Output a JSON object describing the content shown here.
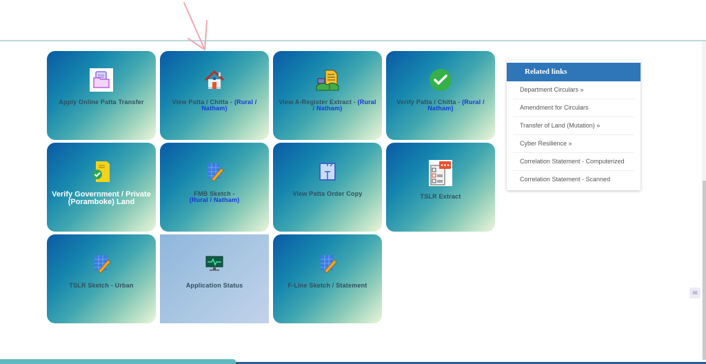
{
  "tiles": [
    {
      "label": "Apply Online Patta Transfer",
      "highlight": "",
      "icon": "folder-document-icon"
    },
    {
      "label": "View Patta / Chitta - ",
      "highlight": "(Rural / Natham)",
      "icon": "house-icon"
    },
    {
      "label": "View A-Register Extract - ",
      "highlight": "(Rural / Natham)",
      "icon": "land-register-icon"
    },
    {
      "label": "Verify Patta / Chitta - ",
      "highlight": "(Rural / Natham)",
      "icon": "check-circle-icon"
    },
    {
      "label": "Verify Government / Private (Poramboke) Land",
      "highlight": "",
      "icon": "verified-document-icon"
    },
    {
      "label": "FMB Sketch - ",
      "highlight": "(Rural / Natham)",
      "icon": "sketch-ruler-icon"
    },
    {
      "label": "View Patta Order Copy",
      "highlight": "",
      "icon": "floor-plan-icon"
    },
    {
      "label": "TSLR Extract",
      "highlight": "",
      "icon": "checklist-icon"
    },
    {
      "label": "TSLR Sketch - Urban",
      "highlight": "",
      "icon": "sketch-ruler-icon"
    },
    {
      "label": "Application Status",
      "highlight": "",
      "icon": "monitor-pulse-icon"
    },
    {
      "label": "F-Line Sketch / Statement",
      "highlight": "",
      "icon": "sketch-ruler-icon"
    }
  ],
  "related_links": {
    "title": "Related links",
    "items": [
      "Department Circulars »",
      "Amendment for Circulars",
      "Transfer of Land (Mutation) »",
      "Cyber Resilience »",
      "Correlation Statement - Computerized",
      "Correlation Statement - Scanned"
    ]
  },
  "colors": {
    "tile_gradient_start": "#0a5aa5",
    "tile_gradient_end": "#eaf5d8",
    "highlight_text": "#1638d6",
    "related_header": "#2f76b9"
  },
  "state": {
    "hovered_tile": "Application Status"
  }
}
